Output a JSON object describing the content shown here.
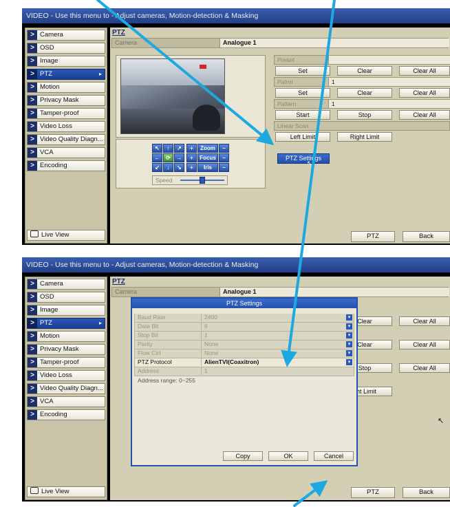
{
  "panel1": {
    "title": "VIDEO - Use this menu to - Adjust cameras, Motion-detection & Masking",
    "sidebar": [
      {
        "label": "Camera"
      },
      {
        "label": "OSD"
      },
      {
        "label": "Image"
      },
      {
        "label": "PTZ",
        "active": true,
        "caret": "▸"
      },
      {
        "label": "Motion"
      },
      {
        "label": "Privacy Mask"
      },
      {
        "label": "Tamper-proof"
      },
      {
        "label": "Video Loss"
      },
      {
        "label": "Video Quality Diagn..."
      },
      {
        "label": "VCA"
      },
      {
        "label": "Encoding"
      }
    ],
    "live_view": "Live View",
    "content_title": "PTZ",
    "camera_label": "Camera",
    "camera_value": "Analogue 1",
    "controls": {
      "zoom": "Zoom",
      "focus": "Focus",
      "iris": "Iris",
      "speed": "Speed",
      "plus": "+",
      "minus": "−"
    },
    "preset": {
      "label": "Preset",
      "set": "Set",
      "clear": "Clear",
      "clear_all": "Clear All"
    },
    "patrol": {
      "label": "Patrol",
      "value": "1",
      "set": "Set",
      "clear": "Clear",
      "clear_all": "Clear All"
    },
    "pattern": {
      "label": "Pattern",
      "value": "1",
      "start": "Start",
      "stop": "Stop",
      "clear_all": "Clear All"
    },
    "linear_scan": {
      "label": "Linear Scan",
      "left": "Left Limit",
      "right": "Right Limit"
    },
    "ptz_settings_menu": "PTZ Settings",
    "ptz_button": "PTZ",
    "back_button": "Back"
  },
  "panel2": {
    "title": "VIDEO - Use this menu to - Adjust cameras, Motion-detection & Masking",
    "content_title": "PTZ",
    "camera_label": "Camera",
    "camera_value": "Analogue 1",
    "dialog": {
      "title": "PTZ Settings",
      "fields": [
        {
          "label": "Baud Rate",
          "value": "2400"
        },
        {
          "label": "Data Bit",
          "value": "8"
        },
        {
          "label": "Stop Bit",
          "value": "1"
        },
        {
          "label": "Parity",
          "value": "None"
        },
        {
          "label": "Flow Ctrl",
          "value": "None"
        },
        {
          "label": "PTZ Protocol",
          "value": "AlienTVI(Coaxitron)",
          "active": true
        },
        {
          "label": "Address",
          "value": "1"
        }
      ],
      "address_range": "Address range: 0~255",
      "copy": "Copy",
      "ok": "OK",
      "cancel": "Cancel"
    },
    "behind": {
      "clear1": "Clear",
      "clear_all1": "Clear All",
      "clear2": "Clear",
      "clear_all2": "Clear All",
      "stop": "Stop",
      "clear_all3": "Clear All",
      "right_limit": "ght Limit"
    },
    "ptz_button": "PTZ",
    "back_button": "Back",
    "live_view": "Live View"
  },
  "colors": {
    "accent_blue": "#2351ab",
    "annotation_arrow": "#1ea8e0",
    "sidebar_bg": "#c9c4a7",
    "content_bg": "#d3cfb4"
  },
  "icons": [
    "chevron-right-icon",
    "live-view-icon",
    "mouse-pointer-icon",
    "ptz-arrow-icon",
    "dropdown-arrow-icon"
  ]
}
